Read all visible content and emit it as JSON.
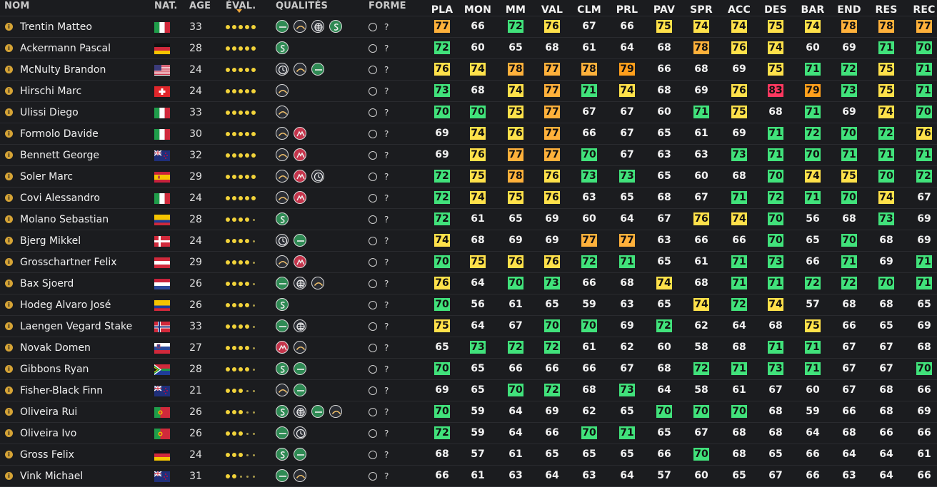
{
  "headers": {
    "nom": "NOM",
    "nat": "NAT.",
    "age": "AGE",
    "eval": "ÉVAL.",
    "qualites": "QUALITÉS",
    "forme": "FORME",
    "stats": [
      "PLA",
      "MON",
      "MM",
      "VAL",
      "CLM",
      "PRL",
      "PAV",
      "SPR",
      "ACC",
      "DES",
      "BAR",
      "END",
      "RES",
      "REC"
    ]
  },
  "colors": {
    "background": "#1b1c1f",
    "rank_79_plus": "#ff9f1c",
    "rank_77_78": "#ffb13b",
    "rank_74_76": "#ffe14a",
    "rank_70_73": "#41e27b",
    "rank_80_plus": "#ff3860",
    "qual_green": "#2f8a54",
    "qual_red": "#c4344b",
    "qual_dark": "#2a2d34"
  },
  "riders": [
    {
      "name": "Trentin Matteo",
      "flag": "italy",
      "age": "33",
      "stars": 5,
      "qualities": [
        "flat",
        "hill",
        "cobble",
        "sprint"
      ],
      "forme": "?",
      "stats": [
        77,
        66,
        72,
        76,
        67,
        66,
        75,
        74,
        74,
        75,
        74,
        78,
        78,
        77
      ]
    },
    {
      "name": "Ackermann Pascal",
      "flag": "germany",
      "age": "28",
      "stars": 5,
      "qualities": [
        "sprint"
      ],
      "forme": "?",
      "stats": [
        72,
        60,
        65,
        68,
        61,
        64,
        68,
        78,
        76,
        74,
        60,
        69,
        71,
        70
      ]
    },
    {
      "name": "McNulty Brandon",
      "flag": "usa",
      "age": "24",
      "stars": 5,
      "qualities": [
        "time",
        "hill",
        "flat"
      ],
      "forme": "?",
      "stats": [
        76,
        74,
        78,
        77,
        78,
        79,
        66,
        68,
        69,
        75,
        71,
        72,
        75,
        71
      ]
    },
    {
      "name": "Hirschi Marc",
      "flag": "switzerland",
      "age": "24",
      "stars": 5,
      "qualities": [
        "hill"
      ],
      "forme": "?",
      "stats": [
        73,
        68,
        74,
        77,
        71,
        74,
        68,
        69,
        76,
        83,
        79,
        73,
        75,
        71
      ]
    },
    {
      "name": "Ulissi Diego",
      "flag": "italy",
      "age": "33",
      "stars": 5,
      "qualities": [
        "hill"
      ],
      "forme": "?",
      "stats": [
        70,
        70,
        75,
        77,
        67,
        67,
        60,
        71,
        75,
        68,
        71,
        69,
        74,
        70
      ]
    },
    {
      "name": "Formolo Davide",
      "flag": "italy",
      "age": "30",
      "stars": 5,
      "qualities": [
        "hill",
        "mountain"
      ],
      "forme": "?",
      "stats": [
        69,
        74,
        76,
        77,
        66,
        67,
        65,
        61,
        69,
        71,
        72,
        70,
        72,
        76
      ]
    },
    {
      "name": "Bennett George",
      "flag": "nz",
      "age": "32",
      "stars": 5,
      "qualities": [
        "hill",
        "mountain"
      ],
      "forme": "?",
      "stats": [
        69,
        76,
        77,
        77,
        70,
        67,
        63,
        63,
        73,
        71,
        70,
        71,
        71,
        71
      ]
    },
    {
      "name": "Soler Marc",
      "flag": "spain",
      "age": "29",
      "stars": 5,
      "qualities": [
        "hill",
        "mountain",
        "time"
      ],
      "forme": "?",
      "stats": [
        72,
        75,
        78,
        76,
        73,
        73,
        65,
        60,
        68,
        70,
        74,
        75,
        70,
        72
      ]
    },
    {
      "name": "Covi Alessandro",
      "flag": "italy",
      "age": "24",
      "stars": 5,
      "qualities": [
        "hill",
        "mountain"
      ],
      "forme": "?",
      "stats": [
        72,
        74,
        75,
        76,
        63,
        65,
        68,
        67,
        71,
        72,
        71,
        70,
        74,
        67
      ]
    },
    {
      "name": "Molano Sebastian",
      "flag": "colombia",
      "age": "28",
      "stars": 4,
      "qualities": [
        "sprint"
      ],
      "forme": "?",
      "stats": [
        72,
        61,
        65,
        69,
        60,
        64,
        67,
        76,
        74,
        70,
        56,
        68,
        73,
        69
      ]
    },
    {
      "name": "Bjerg Mikkel",
      "flag": "denmark",
      "age": "24",
      "stars": 4,
      "qualities": [
        "time",
        "flat"
      ],
      "forme": "?",
      "stats": [
        74,
        68,
        69,
        69,
        77,
        77,
        63,
        66,
        66,
        70,
        65,
        70,
        68,
        69
      ]
    },
    {
      "name": "Grosschartner Felix",
      "flag": "austria",
      "age": "29",
      "stars": 4,
      "qualities": [
        "hill",
        "mountain"
      ],
      "forme": "?",
      "stats": [
        70,
        75,
        76,
        76,
        72,
        71,
        65,
        61,
        71,
        73,
        66,
        71,
        69,
        71
      ]
    },
    {
      "name": "Bax Sjoerd",
      "flag": "netherlands",
      "age": "26",
      "stars": 4,
      "qualities": [
        "flat",
        "cobble",
        "hill"
      ],
      "forme": "?",
      "stats": [
        76,
        64,
        70,
        73,
        66,
        68,
        74,
        68,
        71,
        71,
        72,
        72,
        70,
        71
      ]
    },
    {
      "name": "Hodeg Alvaro José",
      "flag": "colombia",
      "age": "26",
      "stars": 4,
      "qualities": [
        "sprint"
      ],
      "forme": "?",
      "stats": [
        70,
        56,
        61,
        65,
        59,
        63,
        65,
        74,
        72,
        74,
        57,
        68,
        68,
        65
      ]
    },
    {
      "name": "Laengen Vegard Stake",
      "flag": "norway",
      "age": "33",
      "stars": 4,
      "qualities": [
        "flat",
        "cobble"
      ],
      "forme": "?",
      "stats": [
        75,
        64,
        67,
        70,
        70,
        69,
        72,
        62,
        64,
        68,
        75,
        66,
        65,
        69
      ]
    },
    {
      "name": "Novak Domen",
      "flag": "slovenia",
      "age": "27",
      "stars": 4,
      "qualities": [
        "mountain",
        "hill"
      ],
      "forme": "?",
      "stats": [
        65,
        73,
        72,
        72,
        61,
        62,
        60,
        58,
        68,
        71,
        71,
        67,
        67,
        68
      ]
    },
    {
      "name": "Gibbons Ryan",
      "flag": "southafrica",
      "age": "28",
      "stars": 4,
      "qualities": [
        "sprint",
        "flat"
      ],
      "forme": "?",
      "stats": [
        70,
        65,
        66,
        66,
        66,
        67,
        68,
        72,
        71,
        73,
        71,
        67,
        67,
        70
      ]
    },
    {
      "name": "Fisher-Black Finn",
      "flag": "nz",
      "age": "21",
      "stars": 3,
      "qualities": [
        "hill",
        "flat"
      ],
      "forme": "?",
      "stats": [
        69,
        65,
        70,
        72,
        68,
        73,
        64,
        58,
        61,
        67,
        60,
        67,
        68,
        66
      ]
    },
    {
      "name": "Oliveira Rui",
      "flag": "portugal",
      "age": "26",
      "stars": 3,
      "qualities": [
        "sprint",
        "cobble",
        "flat",
        "hill"
      ],
      "forme": "?",
      "stats": [
        70,
        59,
        64,
        69,
        62,
        65,
        70,
        70,
        70,
        68,
        59,
        66,
        68,
        69
      ]
    },
    {
      "name": "Oliveira Ivo",
      "flag": "portugal",
      "age": "26",
      "stars": 3,
      "qualities": [
        "flat",
        "time"
      ],
      "forme": "?",
      "stats": [
        72,
        59,
        64,
        66,
        70,
        71,
        65,
        67,
        68,
        68,
        64,
        68,
        66,
        66
      ]
    },
    {
      "name": "Gross Felix",
      "flag": "germany",
      "age": "24",
      "stars": 3,
      "qualities": [
        "sprint",
        "flat"
      ],
      "forme": "?",
      "stats": [
        68,
        57,
        61,
        65,
        65,
        65,
        66,
        70,
        68,
        65,
        66,
        64,
        64,
        61
      ]
    },
    {
      "name": "Vink Michael",
      "flag": "nz",
      "age": "31",
      "stars": 2,
      "qualities": [
        "flat",
        "hill"
      ],
      "forme": "?",
      "stats": [
        66,
        61,
        63,
        64,
        63,
        64,
        57,
        60,
        65,
        67,
        66,
        63,
        64,
        66
      ]
    }
  ]
}
